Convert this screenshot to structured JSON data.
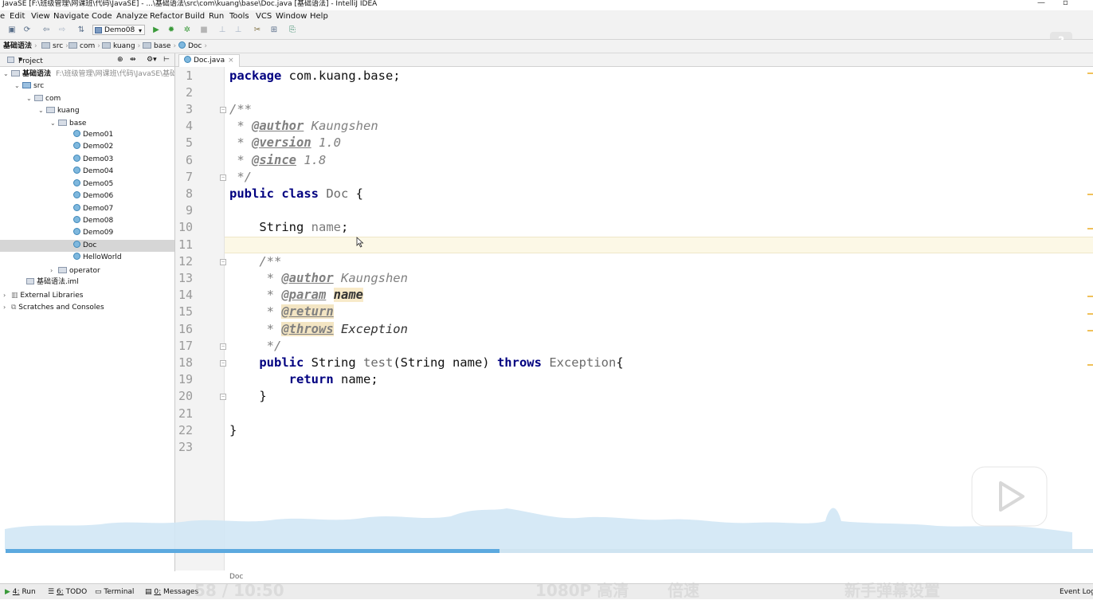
{
  "window": {
    "title": "JavaSE [F:\\班级管理\\网课班\\代码\\JavaSE] - ...\\基础语法\\src\\com\\kuang\\base\\Doc.java [基础语法] - IntelliJ IDEA",
    "minimize": "—",
    "restore": "▫"
  },
  "menu": [
    "e",
    "Edit",
    "View",
    "Navigate",
    "Code",
    "Analyze",
    "Refactor",
    "Build",
    "Run",
    "Tools",
    "VCS",
    "Window",
    "Help"
  ],
  "toolbar": {
    "run_config": "Demo08",
    "icons": [
      "save-icon",
      "sync-icon",
      "back-icon",
      "forward-icon",
      "build-icon",
      "run-icon",
      "debug-icon",
      "coverage-icon",
      "stop-icon",
      "project-structure-icon",
      "settings-icon",
      "sdk-icon",
      "vcs-icon"
    ]
  },
  "breadcrumbs": [
    "基础语法",
    "src",
    "com",
    "kuang",
    "base",
    "Doc"
  ],
  "project_panel": {
    "title": "Project",
    "root_name": "基础语法",
    "root_path": "F:\\班级管理\\网课班\\代码\\JavaSE\\基础",
    "src": "src",
    "com": "com",
    "kuang": "kuang",
    "base": "base",
    "classes": [
      "Demo01",
      "Demo02",
      "Demo03",
      "Demo04",
      "Demo05",
      "Demo06",
      "Demo07",
      "Demo08",
      "Demo09",
      "Doc",
      "HelloWorld"
    ],
    "operator": "operator",
    "iml": "基础语法.iml",
    "external": "External Libraries",
    "scratches": "Scratches and Consoles"
  },
  "editor": {
    "tab_label": "Doc.java",
    "tab_close": "×",
    "footer": "Doc",
    "line_numbers": [
      "1",
      "2",
      "3",
      "4",
      "5",
      "6",
      "7",
      "8",
      "9",
      "10",
      "11",
      "12",
      "13",
      "14",
      "15",
      "16",
      "17",
      "18",
      "19",
      "20",
      "21",
      "22",
      "23"
    ],
    "code": {
      "l1_kw": "package",
      "l1_rest": " com.kuang.base;",
      "l3": "/**",
      "l4_star": " * ",
      "l4_tag": "@author",
      "l4_val": " Kaungshen",
      "l5_star": " * ",
      "l5_tag": "@version",
      "l5_val": " 1.0",
      "l6_star": " * ",
      "l6_tag": "@since",
      "l6_val": " 1.8",
      "l7": " */",
      "l8_kw": "public class",
      "l8_name": " Doc",
      "l8_rest": " {",
      "l10": "    String ",
      "l10_field": "name",
      "l10_end": ";",
      "l12": "    /**",
      "l13_star": "     * ",
      "l13_tag": "@author",
      "l13_val": " Kaungshen",
      "l14_star": "     * ",
      "l14_tag": "@param",
      "l14_sp": " ",
      "l14_val": "name",
      "l15_star": "     * ",
      "l15_tag": "@return",
      "l16_star": "     * ",
      "l16_tag": "@throws",
      "l16_val": " Exception",
      "l17": "     */",
      "l18_ind": "    ",
      "l18_kw": "public",
      "l18_a": " String ",
      "l18_m": "test",
      "l18_b": "(String name) ",
      "l18_kw2": "throws",
      "l18_sp": " ",
      "l18_exc": "Exception",
      "l18_end": "{",
      "l19_ind": "        ",
      "l19_kw": "return",
      "l19_rest": " name;",
      "l20": "    }",
      "l22": "}"
    }
  },
  "status": {
    "run_num": "4:",
    "run": "Run",
    "todo_num": "6:",
    "todo": "TODO",
    "terminal": "Terminal",
    "msg_num": "0:",
    "messages": "Messages",
    "event_log": "Event Log"
  },
  "video_overlay": {
    "time": "58 / 10:50",
    "quality": "1080P 高清",
    "speed": "倍速",
    "player_text": "新手弹幕设置",
    "progress": 0.454
  },
  "colors": {
    "keyword": "#000080",
    "comment": "#808080",
    "progress": "#5ca9df",
    "highlight": "#f8eac9",
    "current_line": "#fcf8e6"
  }
}
